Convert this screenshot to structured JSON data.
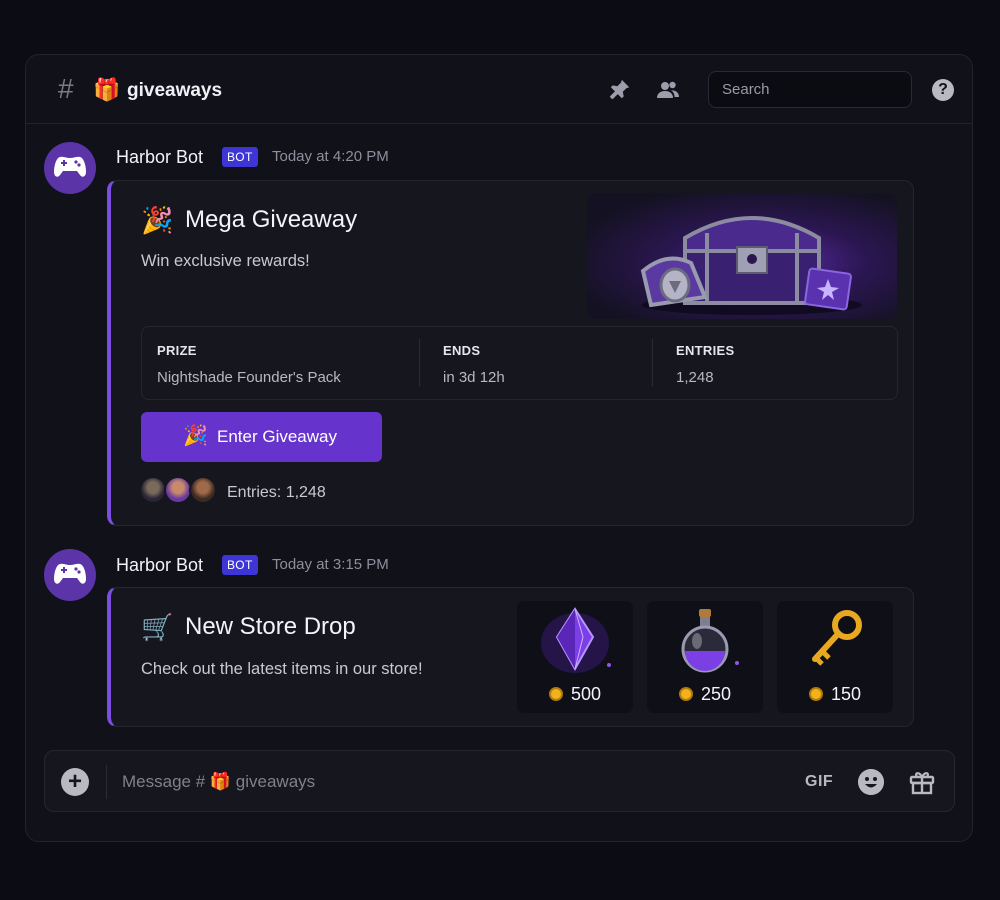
{
  "channel": {
    "hash": "#",
    "emoji": "🎁",
    "name": "giveaways"
  },
  "header": {
    "pin_icon": "pin-icon",
    "members_icon": "members-icon",
    "search_placeholder": "Search",
    "help_icon": "help-icon",
    "help_glyph": "?"
  },
  "messages": [
    {
      "author": "Harbor Bot",
      "badge": "BOT",
      "time": "Today at 4:20 PM",
      "embed": {
        "emoji": "🎉",
        "title": "Mega Giveaway",
        "description": "Win exclusive rewards!",
        "image": "treasure-chest-image",
        "fields": [
          {
            "label": "PRIZE",
            "value": "Nightshade Founder's Pack"
          },
          {
            "label": "ENDS",
            "value": "in 3d 12h"
          },
          {
            "label": "ENTRIES",
            "value": "1,248"
          }
        ],
        "button": {
          "emoji": "🎉",
          "label": "Enter Giveaway"
        },
        "entries_text": "Entries: 1,248"
      }
    },
    {
      "author": "Harbor Bot",
      "badge": "BOT",
      "time": "Today at 3:15 PM",
      "embed": {
        "emoji": "🛒",
        "title": "New Store Drop",
        "description": "Check out the latest items in our store!",
        "items": [
          {
            "icon": "purple-crystal-icon",
            "price": "500"
          },
          {
            "icon": "potion-bottle-icon",
            "price": "250"
          },
          {
            "icon": "golden-key-icon",
            "price": "150"
          }
        ]
      }
    }
  ],
  "composer": {
    "plus_glyph": "+",
    "placeholder": "Message # 🎁 giveaways",
    "gif_label": "GIF"
  },
  "colors": {
    "accent": "#6634cc",
    "embed_border": "#7b4ee0",
    "badge": "#3d35d6",
    "coin": "#f2b21c"
  }
}
